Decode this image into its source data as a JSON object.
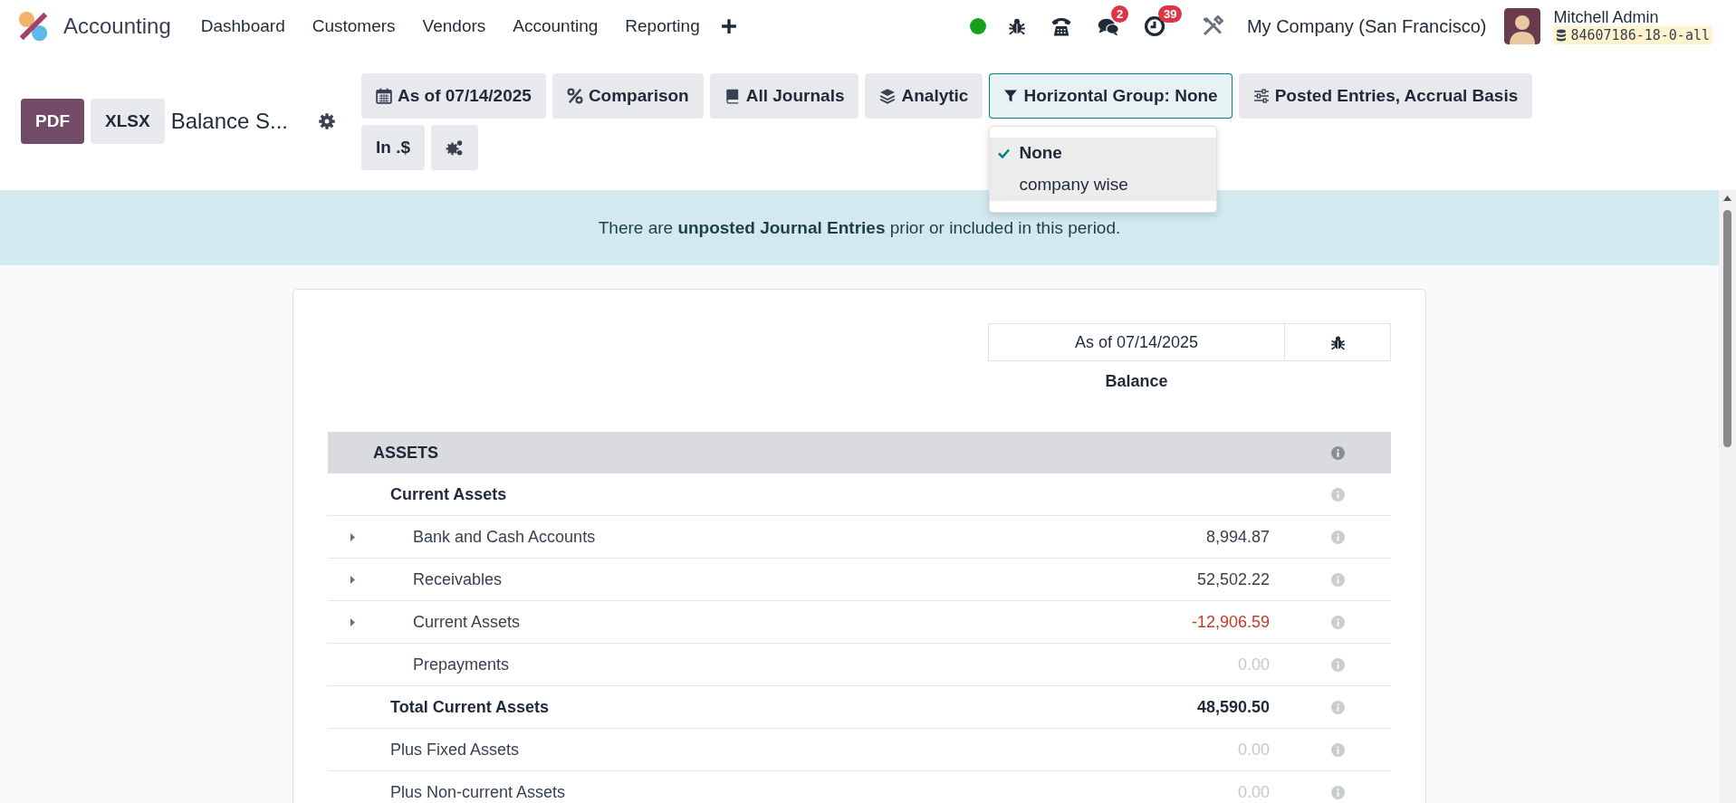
{
  "app": {
    "name": "Accounting"
  },
  "menu": [
    {
      "label": "Dashboard"
    },
    {
      "label": "Customers"
    },
    {
      "label": "Vendors"
    },
    {
      "label": "Accounting"
    },
    {
      "label": "Reporting"
    }
  ],
  "systray": {
    "messages_count": "2",
    "activities_count": "39",
    "company": "My Company (San Francisco)",
    "user": "Mitchell Admin",
    "database": "84607186-18-0-all"
  },
  "export_buttons": [
    {
      "label": "PDF",
      "primary": true
    },
    {
      "label": "XLSX",
      "primary": false
    }
  ],
  "report_title": "Balance S...",
  "filters": [
    [
      {
        "kind": "date",
        "label": "As of 07/14/2025",
        "expanded": false
      },
      {
        "kind": "comparison",
        "label": "Comparison",
        "expanded": false
      },
      {
        "kind": "journals",
        "label": "All Journals",
        "expanded": false
      },
      {
        "kind": "analytic",
        "label": "Analytic",
        "expanded": false
      },
      {
        "kind": "group",
        "label": "Horizontal Group: None",
        "expanded": true
      },
      {
        "kind": "options",
        "label": "Posted Entries, Accrual Basis",
        "expanded": false
      }
    ],
    [
      {
        "kind": "currency",
        "label": "In .$",
        "expanded": false
      },
      {
        "kind": "settings",
        "expanded": false
      }
    ]
  ],
  "dropdown": {
    "options": [
      {
        "label": "None",
        "selected": true
      },
      {
        "label": "company wise",
        "selected": false
      }
    ]
  },
  "alert": {
    "text": "There are **unposted Journal Entries** prior or included in this period."
  },
  "report": {
    "column_header": "As of 07/14/2025",
    "column_label": "Balance",
    "rows": [
      {
        "kind": "section",
        "label": "ASSETS"
      },
      {
        "kind": "group",
        "label": "Current Assets"
      },
      {
        "kind": "line",
        "label": "Bank and Cash Accounts",
        "value": "8,994.87",
        "negative": false,
        "muted": false,
        "expandable": true
      },
      {
        "kind": "line",
        "label": "Receivables",
        "value": "52,502.22",
        "negative": false,
        "muted": false,
        "expandable": true
      },
      {
        "kind": "line",
        "label": "Current Assets",
        "value": "-12,906.59",
        "negative": true,
        "muted": false,
        "expandable": true
      },
      {
        "kind": "line",
        "label": "Prepayments",
        "value": "0.00",
        "negative": false,
        "muted": true,
        "expandable": false
      },
      {
        "kind": "total",
        "label": "Total Current Assets",
        "value": "48,590.50",
        "negative": false,
        "muted": false,
        "expandable": false
      },
      {
        "kind": "plain",
        "label": "Plus Fixed Assets",
        "value": "0.00",
        "negative": false,
        "muted": true,
        "expandable": false
      },
      {
        "kind": "plain",
        "label": "Plus Non-current Assets",
        "value": "0.00",
        "negative": false,
        "muted": true,
        "expandable": false
      }
    ]
  }
}
